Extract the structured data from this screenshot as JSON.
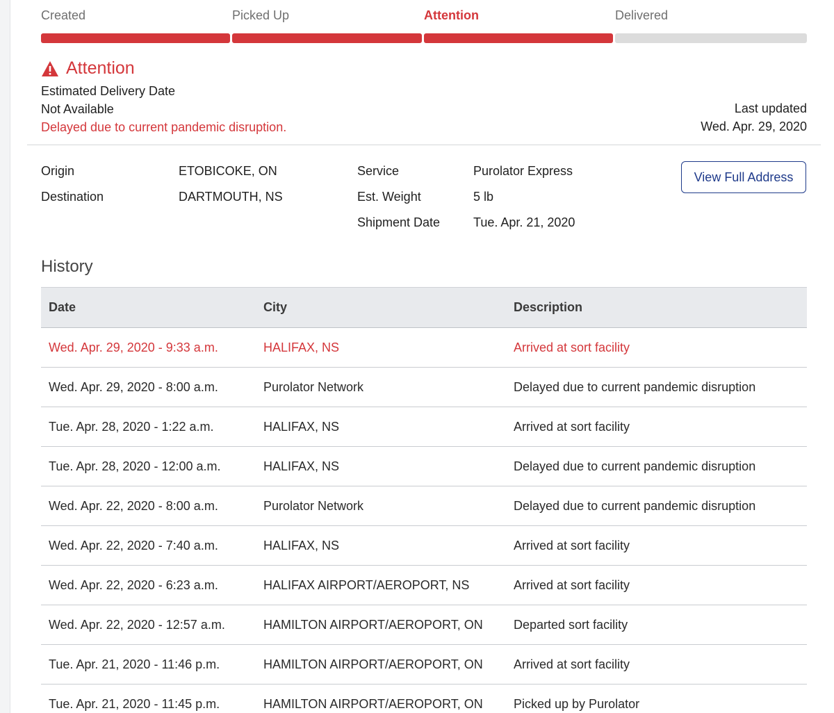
{
  "progress": {
    "steps": [
      {
        "label": "Created",
        "active": false
      },
      {
        "label": "Picked Up",
        "active": false
      },
      {
        "label": "Attention",
        "active": true
      },
      {
        "label": "Delivered",
        "active": false
      }
    ],
    "completed_fraction": 0.75
  },
  "status": {
    "title": "Attention",
    "icon": "warning-icon",
    "eta_label": "Estimated Delivery Date",
    "eta_value": "Not Available",
    "note": "Delayed due to current pandemic disruption.",
    "last_updated_label": "Last updated",
    "last_updated_value": "Wed. Apr. 29, 2020"
  },
  "details": {
    "origin_label": "Origin",
    "origin_value": "ETOBICOKE, ON",
    "destination_label": "Destination",
    "destination_value": "DARTMOUTH, NS",
    "service_label": "Service",
    "service_value": "Purolator Express",
    "weight_label": "Est. Weight",
    "weight_value": "5 lb",
    "shipment_date_label": "Shipment Date",
    "shipment_date_value": "Tue. Apr. 21, 2020",
    "view_address_label": "View Full Address"
  },
  "history": {
    "title": "History",
    "columns": {
      "date": "Date",
      "city": "City",
      "description": "Description"
    },
    "rows": [
      {
        "date": "Wed. Apr. 29, 2020 - 9:33 a.m.",
        "city": "HALIFAX, NS",
        "description": "Arrived at sort facility",
        "highlight": true
      },
      {
        "date": "Wed. Apr. 29, 2020 - 8:00 a.m.",
        "city": "Purolator Network",
        "description": "Delayed due to current pandemic disruption",
        "highlight": false
      },
      {
        "date": "Tue. Apr. 28, 2020 - 1:22 a.m.",
        "city": "HALIFAX, NS",
        "description": "Arrived at sort facility",
        "highlight": false
      },
      {
        "date": "Tue. Apr. 28, 2020 - 12:00 a.m.",
        "city": "HALIFAX, NS",
        "description": "Delayed due to current pandemic disruption",
        "highlight": false
      },
      {
        "date": "Wed. Apr. 22, 2020 - 8:00 a.m.",
        "city": "Purolator Network",
        "description": "Delayed due to current pandemic disruption",
        "highlight": false
      },
      {
        "date": "Wed. Apr. 22, 2020 - 7:40 a.m.",
        "city": "HALIFAX, NS",
        "description": "Arrived at sort facility",
        "highlight": false
      },
      {
        "date": "Wed. Apr. 22, 2020 - 6:23 a.m.",
        "city": "HALIFAX AIRPORT/AEROPORT, NS",
        "description": "Arrived at sort facility",
        "highlight": false
      },
      {
        "date": "Wed. Apr. 22, 2020 - 12:57 a.m.",
        "city": "HAMILTON AIRPORT/AEROPORT, ON",
        "description": "Departed sort facility",
        "highlight": false
      },
      {
        "date": "Tue. Apr. 21, 2020 - 11:46 p.m.",
        "city": "HAMILTON AIRPORT/AEROPORT, ON",
        "description": "Arrived at sort facility",
        "highlight": false
      },
      {
        "date": "Tue. Apr. 21, 2020 - 11:45 p.m.",
        "city": "HAMILTON AIRPORT/AEROPORT, ON",
        "description": "Picked up by Purolator",
        "highlight": false
      }
    ]
  },
  "colors": {
    "accent": "#d4373b",
    "button_border": "#1e3a8a",
    "track_inactive": "#dcdcdc"
  }
}
